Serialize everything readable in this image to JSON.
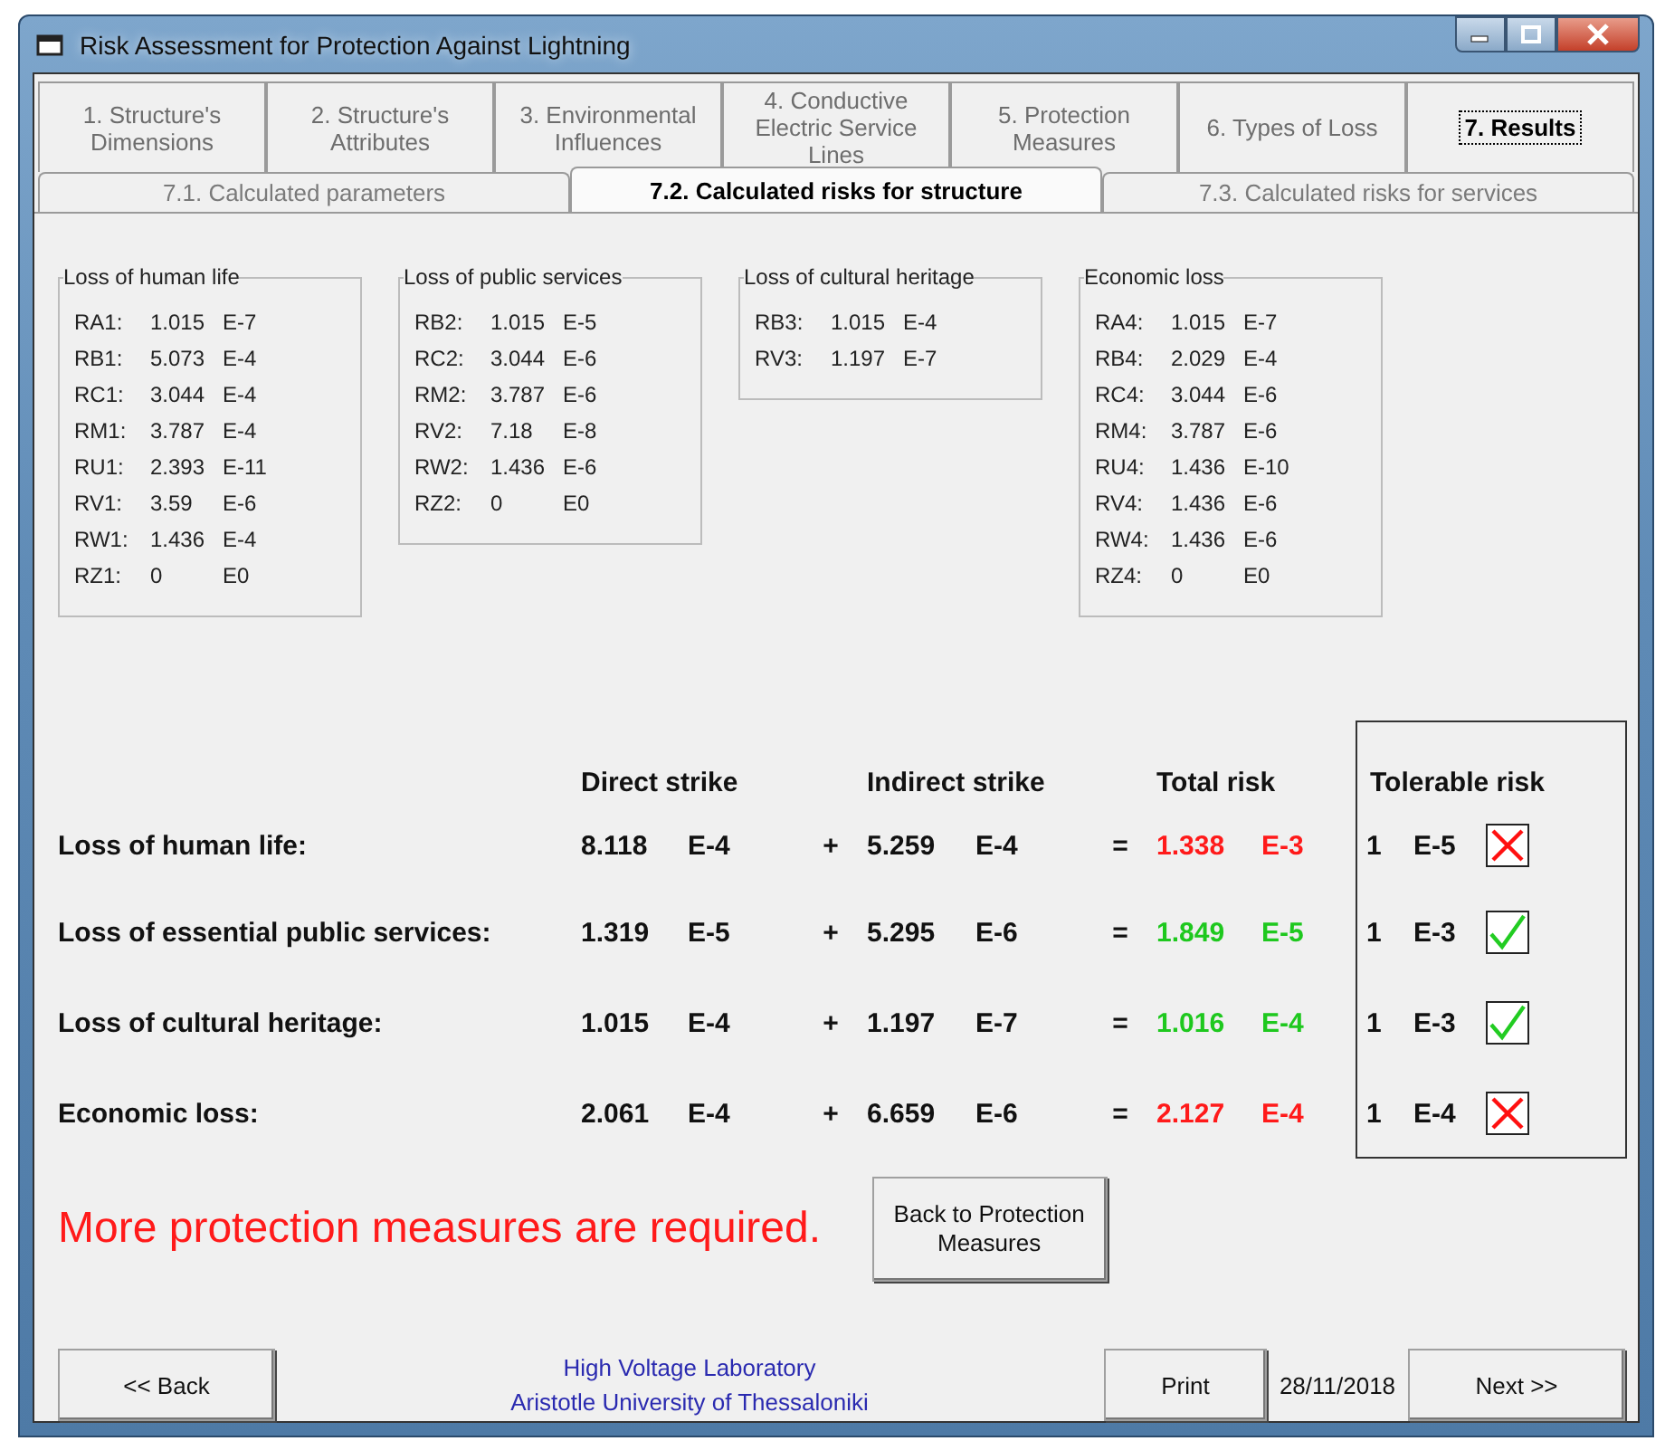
{
  "window": {
    "title": "Risk Assessment for Protection Against Lightning"
  },
  "tabs": [
    {
      "label": "1. Structure's Dimensions",
      "selected": false
    },
    {
      "label": "2. Structure's Attributes",
      "selected": false
    },
    {
      "label": "3. Environmental Influences",
      "selected": false
    },
    {
      "label": "4. Conductive Electric Service Lines",
      "selected": false
    },
    {
      "label": "5. Protection Measures",
      "selected": false
    },
    {
      "label": "6. Types of Loss",
      "selected": false
    },
    {
      "label": "7. Results",
      "selected": true
    }
  ],
  "subtabs": [
    {
      "label": "7.1. Calculated parameters",
      "selected": false
    },
    {
      "label": "7.2. Calculated risks for structure",
      "selected": true
    },
    {
      "label": "7.3. Calculated risks for services",
      "selected": false
    }
  ],
  "groups": [
    {
      "title": "Loss of human life",
      "items": [
        [
          "RA1:",
          "1.015",
          "E-7"
        ],
        [
          "RB1:",
          "5.073",
          "E-4"
        ],
        [
          "RC1:",
          "3.044",
          "E-4"
        ],
        [
          "RM1:",
          "3.787",
          "E-4"
        ],
        [
          "RU1:",
          "2.393",
          "E-11"
        ],
        [
          "RV1:",
          "3.59",
          "E-6"
        ],
        [
          "RW1:",
          "1.436",
          "E-4"
        ],
        [
          "RZ1:",
          "0",
          "E0"
        ]
      ]
    },
    {
      "title": "Loss of public services",
      "items": [
        [
          "RB2:",
          "1.015",
          "E-5"
        ],
        [
          "RC2:",
          "3.044",
          "E-6"
        ],
        [
          "RM2:",
          "3.787",
          "E-6"
        ],
        [
          "RV2:",
          "7.18",
          "E-8"
        ],
        [
          "RW2:",
          "1.436",
          "E-6"
        ],
        [
          "RZ2:",
          "0",
          "E0"
        ]
      ]
    },
    {
      "title": "Loss of cultural heritage",
      "items": [
        [
          "RB3:",
          "1.015",
          "E-4"
        ],
        [
          "RV3:",
          "1.197",
          "E-7"
        ]
      ]
    },
    {
      "title": "Economic loss",
      "items": [
        [
          "RA4:",
          "1.015",
          "E-7"
        ],
        [
          "RB4:",
          "2.029",
          "E-4"
        ],
        [
          "RC4:",
          "3.044",
          "E-6"
        ],
        [
          "RM4:",
          "3.787",
          "E-6"
        ],
        [
          "RU4:",
          "1.436",
          "E-10"
        ],
        [
          "RV4:",
          "1.436",
          "E-6"
        ],
        [
          "RW4:",
          "1.436",
          "E-6"
        ],
        [
          "RZ4:",
          "0",
          "E0"
        ]
      ]
    }
  ],
  "results": {
    "headers": {
      "direct": "Direct strike",
      "indirect": "Indirect strike",
      "total": "Total risk",
      "tolerable": "Tolerable risk"
    },
    "rows": [
      {
        "label": "Loss of human life:",
        "direct": [
          "8.118",
          "E-4"
        ],
        "plus": "+",
        "indirect": [
          "5.259",
          "E-4"
        ],
        "equals": "=",
        "total": [
          "1.338",
          "E-3"
        ],
        "tolerable": [
          "1",
          "E-5"
        ],
        "exceeded": true
      },
      {
        "label": "Loss of essential public services:",
        "direct": [
          "1.319",
          "E-5"
        ],
        "plus": "+",
        "indirect": [
          "5.295",
          "E-6"
        ],
        "equals": "=",
        "total": [
          "1.849",
          "E-5"
        ],
        "tolerable": [
          "1",
          "E-3"
        ],
        "exceeded": false
      },
      {
        "label": "Loss of cultural heritage:",
        "direct": [
          "1.015",
          "E-4"
        ],
        "plus": "+",
        "indirect": [
          "1.197",
          "E-7"
        ],
        "equals": "=",
        "total": [
          "1.016",
          "E-4"
        ],
        "tolerable": [
          "1",
          "E-3"
        ],
        "exceeded": false
      },
      {
        "label": "Economic loss:",
        "direct": [
          "2.061",
          "E-4"
        ],
        "plus": "+",
        "indirect": [
          "6.659",
          "E-6"
        ],
        "equals": "=",
        "total": [
          "2.127",
          "E-4"
        ],
        "tolerable": [
          "1",
          "E-4"
        ],
        "exceeded": true
      }
    ]
  },
  "message": "More protection measures are required.",
  "back_to_protection": "Back to Protection Measures",
  "footer": {
    "back": "<< Back",
    "lab": [
      "High Voltage Laboratory",
      "Aristotle University of Thessaloniki"
    ],
    "print": "Print",
    "date": "28/11/2018",
    "next": "Next >>"
  }
}
